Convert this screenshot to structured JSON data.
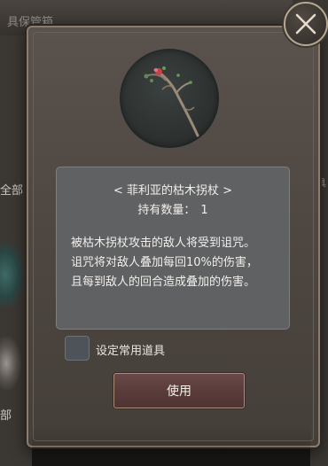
{
  "background": {
    "title": "具保管箱",
    "left_label_top": "全部",
    "left_label_bottom": "部",
    "right_label": "具"
  },
  "item": {
    "name": "< 菲利亚的枯木拐杖 >",
    "quantity_label": "持有数量：",
    "quantity_value": "1",
    "icon": "withered-staff-icon",
    "description_lines": [
      "被枯木拐杖攻击的敌人将受到诅咒。",
      "诅咒将对敌人叠加每回10%的伤害，",
      "且每到敌人的回合造成叠加的伤害。"
    ]
  },
  "favorite": {
    "label": "设定常用道具",
    "checked": false
  },
  "use_button": {
    "label": "使用"
  },
  "colors": {
    "accent": "#b6a992",
    "button": "#5a3c3b"
  }
}
